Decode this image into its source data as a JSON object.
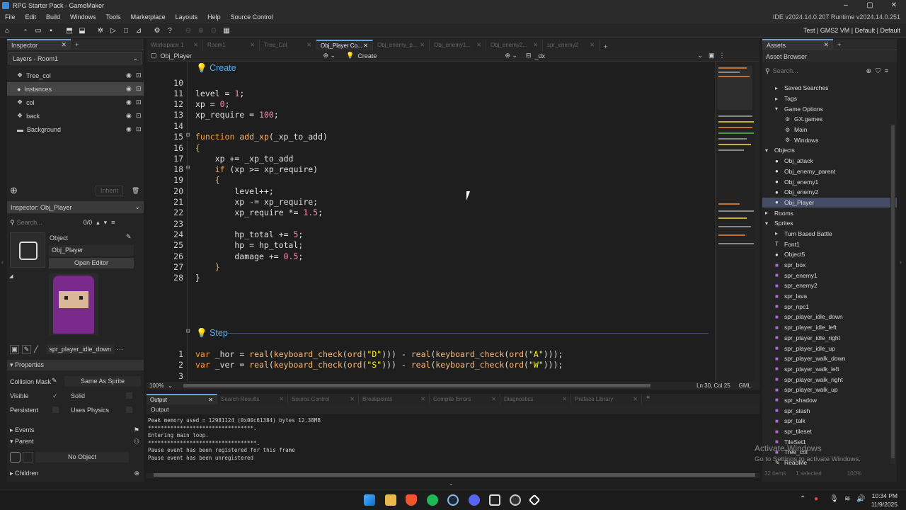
{
  "window": {
    "title": "RPG Starter Pack - GameMaker",
    "controls": [
      "–",
      "▢",
      "✕"
    ]
  },
  "menu": {
    "items": [
      "File",
      "Edit",
      "Build",
      "Windows",
      "Tools",
      "Marketplace",
      "Layouts",
      "Help",
      "Source Control"
    ],
    "version": "IDE v2024.14.0.207  Runtime v2024.14.0.251"
  },
  "toolbar": {
    "target": "Test | GMS2 VM | Default | Default"
  },
  "inspector": {
    "tab": "Inspector",
    "layers_title": "Layers - Room1",
    "layers": [
      "Tree_col",
      "Instances",
      "col",
      "back",
      "Background"
    ],
    "inherit": "Inherit",
    "obj_title": "Inspector: Obj_Player",
    "search_placeholder": "Search...",
    "search_count": "0/0",
    "object_label": "Object",
    "object_name": "Obj_Player",
    "open_editor": "Open Editor",
    "sprite_name": "spr_player_idle_down",
    "properties": "Properties",
    "collision_mask": "Collision Mask",
    "same_as_sprite": "Same As Sprite",
    "visible": "Visible",
    "solid": "Solid",
    "persistent": "Persistent",
    "uses_physics": "Uses Physics",
    "events": "Events",
    "parent": "Parent",
    "no_object": "No Object",
    "children": "Children"
  },
  "editor": {
    "tabs": [
      "Workspace 1",
      "Room1",
      "Tree_Col",
      "Obj_Player Co...",
      "Obj_enemy_p...",
      "Obj_enemy1...",
      "Obj_enemy2...",
      "spr_enemy2"
    ],
    "active_tab": "Obj_Player Co...",
    "subtab_object": "Obj_Player",
    "subtab_event": "Create",
    "subtab_file": "_dx",
    "create_header": "Create",
    "step_header": "Step",
    "zoom": "100%",
    "cursor": "Ln 30, Col 25",
    "lang": "GML",
    "line_numbers": [
      "10",
      "11",
      "12",
      "13",
      "14",
      "15",
      "16",
      "17",
      "18",
      "19",
      "20",
      "21",
      "22",
      "23",
      "24",
      "25",
      "26",
      "27",
      "28"
    ],
    "step_lines": [
      "1",
      "2",
      "3"
    ]
  },
  "output": {
    "tabs": [
      "Output",
      "Search Results",
      "Source Control",
      "Breakpoints",
      "Compile Errors",
      "Diagnostics",
      "Preface Library"
    ],
    "label": "Output",
    "lines": [
      "Peak memory used = 12981124 (0x00c61384) bytes 12.38MB",
      "*********************************.",
      "Entering main loop.",
      "**********************************.",
      "Pause event has been registered for this frame",
      "Pause event has been unregistered"
    ]
  },
  "assets": {
    "tab": "Assets",
    "browser": "Asset Browser",
    "search_placeholder": "Search...",
    "items": [
      {
        "label": "Saved Searches",
        "indent": 1,
        "icon": "tri"
      },
      {
        "label": "Tags",
        "indent": 1,
        "icon": "tri"
      },
      {
        "label": "Game Options",
        "indent": 1,
        "icon": "tri-open"
      },
      {
        "label": "GX.games",
        "indent": 2,
        "icon": "gear"
      },
      {
        "label": "Main",
        "indent": 2,
        "icon": "gear"
      },
      {
        "label": "Windows",
        "indent": 2,
        "icon": "gear"
      },
      {
        "label": "Objects",
        "indent": 0,
        "icon": "tri-open"
      },
      {
        "label": "Obj_attack",
        "indent": 1,
        "icon": "obj"
      },
      {
        "label": "Obj_enemy_parent",
        "indent": 1,
        "icon": "obj"
      },
      {
        "label": "Obj_enemy1",
        "indent": 1,
        "icon": "obj"
      },
      {
        "label": "Obj_enemy2",
        "indent": 1,
        "icon": "obj"
      },
      {
        "label": "Obj_Player",
        "indent": 1,
        "icon": "obj",
        "selected": true
      },
      {
        "label": "Rooms",
        "indent": 0,
        "icon": "tri"
      },
      {
        "label": "Sprites",
        "indent": 0,
        "icon": "tri-open"
      },
      {
        "label": "Turn Based Battle",
        "indent": 1,
        "icon": "tri"
      },
      {
        "label": "Font1",
        "indent": 1,
        "icon": "font"
      },
      {
        "label": "Object5",
        "indent": 1,
        "icon": "obj"
      },
      {
        "label": "spr_box",
        "indent": 1,
        "icon": "spr"
      },
      {
        "label": "spr_enemy1",
        "indent": 1,
        "icon": "spr"
      },
      {
        "label": "spr_enemy2",
        "indent": 1,
        "icon": "spr"
      },
      {
        "label": "spr_lava",
        "indent": 1,
        "icon": "spr"
      },
      {
        "label": "spr_npc1",
        "indent": 1,
        "icon": "spr"
      },
      {
        "label": "spr_player_idle_down",
        "indent": 1,
        "icon": "spr"
      },
      {
        "label": "spr_player_idle_left",
        "indent": 1,
        "icon": "spr"
      },
      {
        "label": "spr_player_idle_right",
        "indent": 1,
        "icon": "spr"
      },
      {
        "label": "spr_player_idle_up",
        "indent": 1,
        "icon": "spr"
      },
      {
        "label": "spr_player_walk_down",
        "indent": 1,
        "icon": "spr"
      },
      {
        "label": "spr_player_walk_left",
        "indent": 1,
        "icon": "spr"
      },
      {
        "label": "spr_player_walk_right",
        "indent": 1,
        "icon": "spr"
      },
      {
        "label": "spr_player_walk_up",
        "indent": 1,
        "icon": "spr"
      },
      {
        "label": "spr_shadow",
        "indent": 1,
        "icon": "spr"
      },
      {
        "label": "spr_slash",
        "indent": 1,
        "icon": "spr"
      },
      {
        "label": "spr_talk",
        "indent": 1,
        "icon": "spr"
      },
      {
        "label": "spr_tileset",
        "indent": 1,
        "icon": "spr"
      },
      {
        "label": "TileSet1",
        "indent": 1,
        "icon": "spr"
      },
      {
        "label": "Tree_col",
        "indent": 1,
        "icon": "spr"
      },
      {
        "label": "ReadMe",
        "indent": 1,
        "icon": "note"
      }
    ],
    "footer_count": "32 items",
    "footer_selected": "1 selected",
    "footer_zoom": "100%"
  },
  "watermark": {
    "line1": "Activate Windows",
    "line2": "Go to Settings to activate Windows."
  },
  "clock": {
    "time": "10:34 PM",
    "date": "11/9/2025"
  },
  "colors": {
    "accent": "#6fa3d8",
    "keyword": "#ff9f2f",
    "number": "#ff86b8",
    "string": "#fcf320"
  }
}
